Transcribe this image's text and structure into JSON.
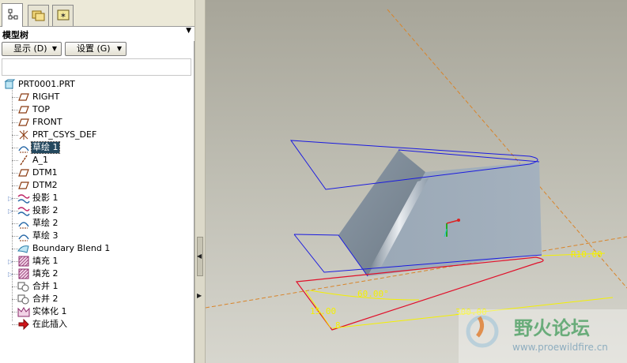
{
  "panel": {
    "title": "模型树",
    "buttons": {
      "show": "显示 (D)",
      "settings": "设置 (G)"
    }
  },
  "tree": {
    "items": [
      {
        "label": "PRT0001.PRT",
        "icon": "part-icon",
        "depth": 0
      },
      {
        "label": "RIGHT",
        "icon": "datum-plane-icon",
        "depth": 1
      },
      {
        "label": "TOP",
        "icon": "datum-plane-icon",
        "depth": 1
      },
      {
        "label": "FRONT",
        "icon": "datum-plane-icon",
        "depth": 1
      },
      {
        "label": "PRT_CSYS_DEF",
        "icon": "csys-icon",
        "depth": 1
      },
      {
        "label": "草绘 1",
        "icon": "sketch-icon",
        "depth": 1,
        "selected": true
      },
      {
        "label": "A_1",
        "icon": "datum-axis-icon",
        "depth": 1
      },
      {
        "label": "DTM1",
        "icon": "datum-plane-icon",
        "depth": 1
      },
      {
        "label": "DTM2",
        "icon": "datum-plane-icon",
        "depth": 1
      },
      {
        "label": "投影 1",
        "icon": "projection-icon",
        "depth": 1,
        "expandable": true
      },
      {
        "label": "投影 2",
        "icon": "projection-icon",
        "depth": 1,
        "expandable": true
      },
      {
        "label": "草绘 2",
        "icon": "sketch-icon",
        "depth": 1
      },
      {
        "label": "草绘 3",
        "icon": "sketch-icon",
        "depth": 1
      },
      {
        "label": "Boundary Blend 1",
        "icon": "boundary-blend-icon",
        "depth": 1
      },
      {
        "label": "填充 1",
        "icon": "fill-icon",
        "depth": 1,
        "expandable": true
      },
      {
        "label": "填充 2",
        "icon": "fill-icon",
        "depth": 1,
        "expandable": true
      },
      {
        "label": "合并 1",
        "icon": "merge-icon",
        "depth": 1
      },
      {
        "label": "合并 2",
        "icon": "merge-icon",
        "depth": 1
      },
      {
        "label": "实体化 1",
        "icon": "solidify-icon",
        "depth": 1
      },
      {
        "label": "在此插入",
        "icon": "insert-here-icon",
        "depth": 1
      }
    ]
  },
  "viewport": {
    "dimensions": {
      "d1": "R10.00",
      "d2": "60.00°",
      "d3": "15.00",
      "d4": "300.00",
      "d5": "8"
    }
  },
  "watermark": {
    "title": "野火论坛",
    "url": "www.proewildfire.cn"
  },
  "colors": {
    "selection": "#24485e",
    "sketch_curve": "#1a1ae0",
    "dimension": "#f4f000",
    "highlight_curve": "#e0102a",
    "datum_line": "#d8842a",
    "viewport_bg": "#bdbcb1",
    "watermark_text": "#1a8a3a"
  }
}
